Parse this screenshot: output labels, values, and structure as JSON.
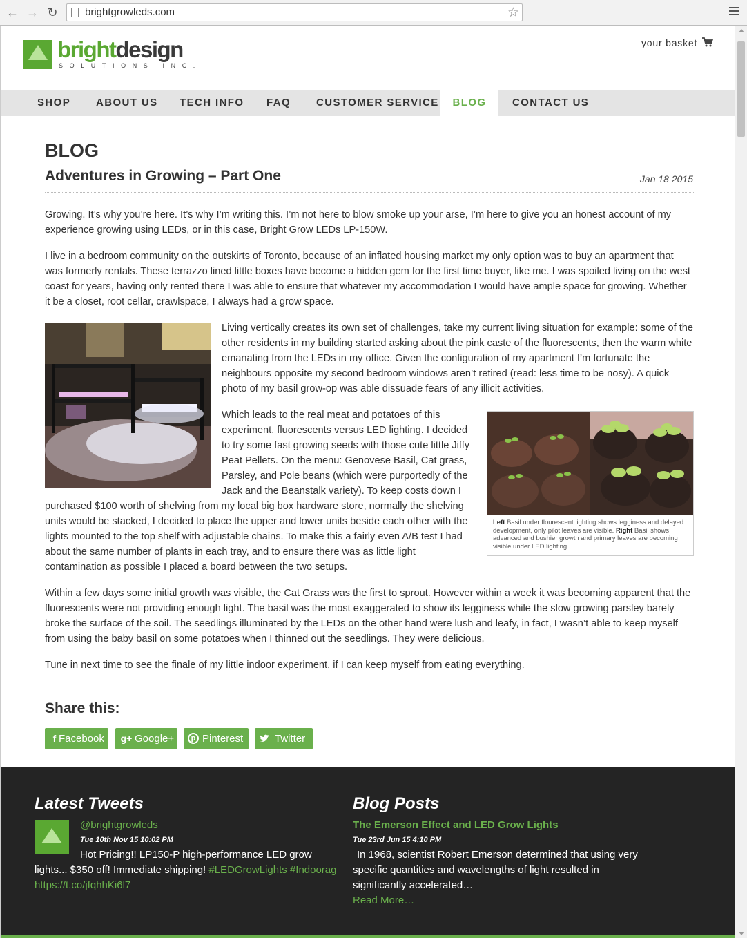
{
  "browser": {
    "url": "brightgrowleds.com"
  },
  "header": {
    "logo_bright": "bright",
    "logo_design": "design",
    "logo_tagline": "SOLUTIONS INC.",
    "basket_label": "your basket"
  },
  "nav": {
    "items": [
      "SHOP",
      "ABOUT US",
      "TECH INFO",
      "FAQ",
      "CUSTOMER SERVICE",
      "BLOG",
      "CONTACT US"
    ],
    "active": "BLOG"
  },
  "main": {
    "section_heading": "BLOG",
    "post_title": "Adventures in Growing – Part One",
    "post_date": "Jan 18 2015",
    "paragraphs": [
      "Growing. It’s why you’re here. It’s why I’m writing this. I’m not here to blow smoke up your arse, I’m here to give you an honest account of my experience growing using LEDs, or in this case, Bright Grow LEDs LP-150W.",
      "I live in a bedroom community on the outskirts of Toronto, because of an inflated housing market my only option was to buy an apartment that was formerly rentals. These terrazzo lined little boxes have become a hidden gem for the first time buyer, like me. I was spoiled living on the west coast for years, having only rented there I was able to ensure that whatever my accommodation I would have ample space for growing. Whether it be a closet, root cellar, crawlspace, I always had a grow space.",
      "Living vertically creates its own set of challenges, take my current living situation for example: some of the other residents in my building started asking about the pink caste of the fluorescents, then the warm white emanating from the LEDs in my office. Given the configuration of my apartment I’m fortunate the neighbours opposite my second bedroom windows aren’t retired (read: less time to be nosy). A quick photo of my basil grow-op was able dissuade fears of any illicit activities.",
      "Which leads to the real meat and potatoes of this experiment, fluorescents versus LED lighting. I decided to try some fast growing seeds with those cute little Jiffy Peat Pellets. On the menu: Genovese Basil, Cat grass, Parsley, and Pole beans (which were purportedly of the Jack and the Beanstalk variety). To keep costs down I purchased $100 worth of shelving from my local big box hardware store, normally the shelving units would be stacked, I decided to place the upper and lower units beside each other with the lights mounted to the top shelf with adjustable chains. To make this a fairly even A/B test I had about the same number of plants in each tray, and to ensure there was as little light contamination as possible I placed a board between the two setups.",
      "Within a few days some initial growth was visible, the Cat Grass was the first to sprout. However within a week it was becoming apparent that the fluorescents were not providing enough light. The basil was the most exaggerated to show its legginess while the slow growing parsley barely broke the surface of the soil. The seedlings illuminated by the LEDs on the other hand were lush and leafy, in fact, I wasn’t able to keep myself from using the baby basil on some potatoes when I thinned out the seedlings. They were delicious.",
      "Tune in next time to see the finale of my little indoor experiment, if I can keep myself from eating everything."
    ],
    "caption": {
      "left_label": "Left",
      "left_text": " Basil under flourescent lighting shows legginess and delayed development, only pilot leaves are visible. ",
      "right_label": "Right",
      "right_text": " Basil shows advanced and bushier growth and primary leaves are becoming visible under LED lighting."
    }
  },
  "share": {
    "heading": "Share this:",
    "buttons": [
      {
        "label": "Facebook",
        "icon": "facebook-icon"
      },
      {
        "label": "Google+",
        "icon": "google-plus-icon"
      },
      {
        "label": "Pinterest",
        "icon": "pinterest-icon"
      },
      {
        "label": "Twitter",
        "icon": "twitter-icon"
      }
    ]
  },
  "footer": {
    "tweets_heading": "Latest Tweets",
    "tweet_handle": "@brightgrowleds",
    "tweet_time": "Tue 10th Nov 15 10:02 PM",
    "tweet_text": "Hot Pricing!! LP150-P high-performance LED grow lights... $350 off! Immediate shipping! ",
    "tweet_hashtags": "#LEDGrowLights #Indoorag",
    "tweet_link": "https://t.co/jfqhhKi6l7",
    "blog_heading": "Blog Posts",
    "blog_post_title": "The Emerson Effect and LED Grow Lights",
    "blog_post_time": "Tue 23rd Jun 15 4:10 PM",
    "blog_post_excerpt": "In 1968, scientist Robert Emerson determined that using very specific quantities and wavelengths of light resulted in significantly accelerated…",
    "read_more": "Read More…"
  },
  "colors": {
    "accent": "#6ab04c",
    "footer_bg": "#242424",
    "nav_bg": "#e4e4e4"
  }
}
